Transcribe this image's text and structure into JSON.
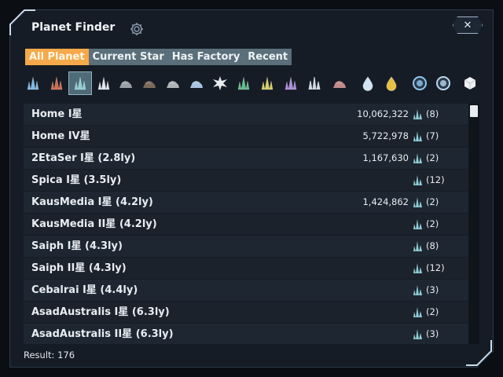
{
  "window": {
    "title": "Planet Finder",
    "close_label": "✕"
  },
  "tabs": [
    {
      "label": "All Planet",
      "active": true
    },
    {
      "label": "Current Star",
      "active": false
    },
    {
      "label": "Has Factory",
      "active": false
    },
    {
      "label": "Recent",
      "active": false
    }
  ],
  "resource_icons": [
    {
      "name": "blue-crystal-icon",
      "color": "#7db8e8",
      "selected": false
    },
    {
      "name": "red-crystal-icon",
      "color": "#d86a4a",
      "selected": false
    },
    {
      "name": "teal-crystal-icon",
      "color": "#8fd0d8",
      "selected": true
    },
    {
      "name": "white-crystal-icon",
      "color": "#dfe7ee",
      "selected": false
    },
    {
      "name": "iron-ore-icon",
      "color": "#9aa2a8",
      "selected": false
    },
    {
      "name": "dark-ore-icon",
      "color": "#7a6a5a",
      "selected": false
    },
    {
      "name": "stone-ore-icon",
      "color": "#b0b4b6",
      "selected": false
    },
    {
      "name": "silicon-ore-icon",
      "color": "#a8c4e0",
      "selected": false
    },
    {
      "name": "spiky-crystal-icon",
      "color": "#e8ecef",
      "selected": false
    },
    {
      "name": "green-crystal-icon",
      "color": "#5fc08a",
      "selected": false
    },
    {
      "name": "yellow-crystal-icon",
      "color": "#d8d060",
      "selected": false
    },
    {
      "name": "purple-crystal-icon",
      "color": "#b08ae0",
      "selected": false
    },
    {
      "name": "white-spire-icon",
      "color": "#d0d8e0",
      "selected": false
    },
    {
      "name": "red-ore-icon",
      "color": "#c08a8a",
      "selected": false
    },
    {
      "name": "water-drop-icon",
      "color": "#cfe4f2",
      "selected": false
    },
    {
      "name": "oil-drop-icon",
      "color": "#e8c040",
      "selected": false
    },
    {
      "name": "blue-orb-icon",
      "color": "#8ec8f0",
      "selected": false
    },
    {
      "name": "ringed-orb-icon",
      "color": "#b8d8f0",
      "selected": false
    },
    {
      "name": "white-cube-icon",
      "color": "#f0f2f4",
      "selected": false
    }
  ],
  "planets": [
    {
      "name": "Home I星",
      "amount": "10,062,322",
      "count": "(8)"
    },
    {
      "name": "Home IV星",
      "amount": "5,722,978",
      "count": "(7)"
    },
    {
      "name": "2EtaSer I星 (2.8ly)",
      "amount": "1,167,630",
      "count": "(2)"
    },
    {
      "name": "Spica I星 (3.5ly)",
      "amount": "",
      "count": "(12)"
    },
    {
      "name": "KausMedia I星 (4.2ly)",
      "amount": "1,424,862",
      "count": "(2)"
    },
    {
      "name": "KausMedia II星 (4.2ly)",
      "amount": "",
      "count": "(2)"
    },
    {
      "name": "Saiph I星 (4.3ly)",
      "amount": "",
      "count": "(8)"
    },
    {
      "name": "Saiph II星 (4.3ly)",
      "amount": "",
      "count": "(12)"
    },
    {
      "name": "Cebalrai I星 (4.4ly)",
      "amount": "",
      "count": "(3)"
    },
    {
      "name": "AsadAustralis I星 (6.3ly)",
      "amount": "",
      "count": "(2)"
    },
    {
      "name": "AsadAustralis II星 (6.3ly)",
      "amount": "",
      "count": "(3)"
    }
  ],
  "result": {
    "text": "Result: 176"
  },
  "colors": {
    "accent": "#f5a94a",
    "tab_bar": "#5a6f7a",
    "panel": "#161c26",
    "row": "#1e2631"
  }
}
